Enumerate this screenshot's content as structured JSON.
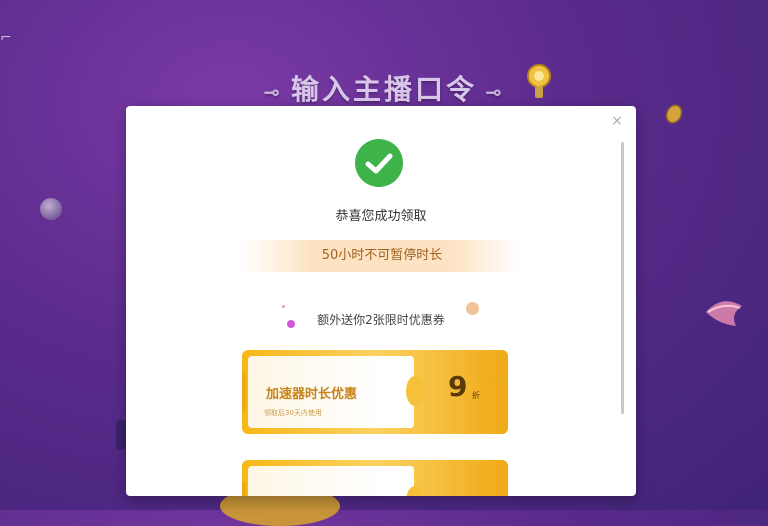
{
  "background": {
    "title": "输入主播口令",
    "left_deco": "⊸",
    "right_deco": "⊸",
    "accent_color": "#5b2b8c"
  },
  "dialog": {
    "close_icon": "close-icon",
    "success_icon": "check-circle-icon",
    "congrats_text": "恭喜您成功领取",
    "reward_text": "50小时不可暂停时长",
    "extra_text": "额外送你2张限时优惠券",
    "accent_color": "#3db34a",
    "coupon_color": "#f7b716",
    "coupons": [
      {
        "name": "加速器时长优惠",
        "desc": "领取后30天内使用",
        "value": "9",
        "unit": "折"
      },
      {
        "name": "",
        "desc": "",
        "value": "",
        "unit": ""
      }
    ]
  }
}
